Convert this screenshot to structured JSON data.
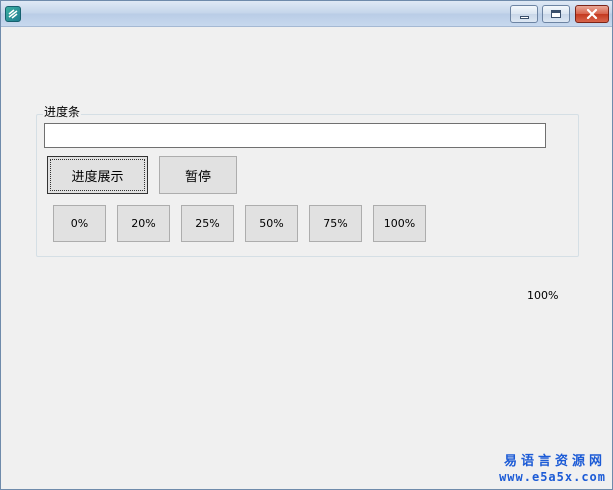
{
  "window": {
    "title": "",
    "icon": "app-icon",
    "controls": [
      "minimize-icon",
      "maximize-icon",
      "close-icon"
    ]
  },
  "group": {
    "label": "进度条",
    "progress_value": 0
  },
  "buttons": {
    "show": "进度展示",
    "pause": "暂停",
    "presets": [
      "0%",
      "20%",
      "25%",
      "50%",
      "75%",
      "100%"
    ]
  },
  "status_label": "100%",
  "watermark": {
    "name": "易语言资源网",
    "url": "www.e5a5x.com"
  },
  "colors": {
    "watermark": "#1c5bd6",
    "close_button": "#c4391f",
    "window_bg": "#f0f0f0"
  }
}
